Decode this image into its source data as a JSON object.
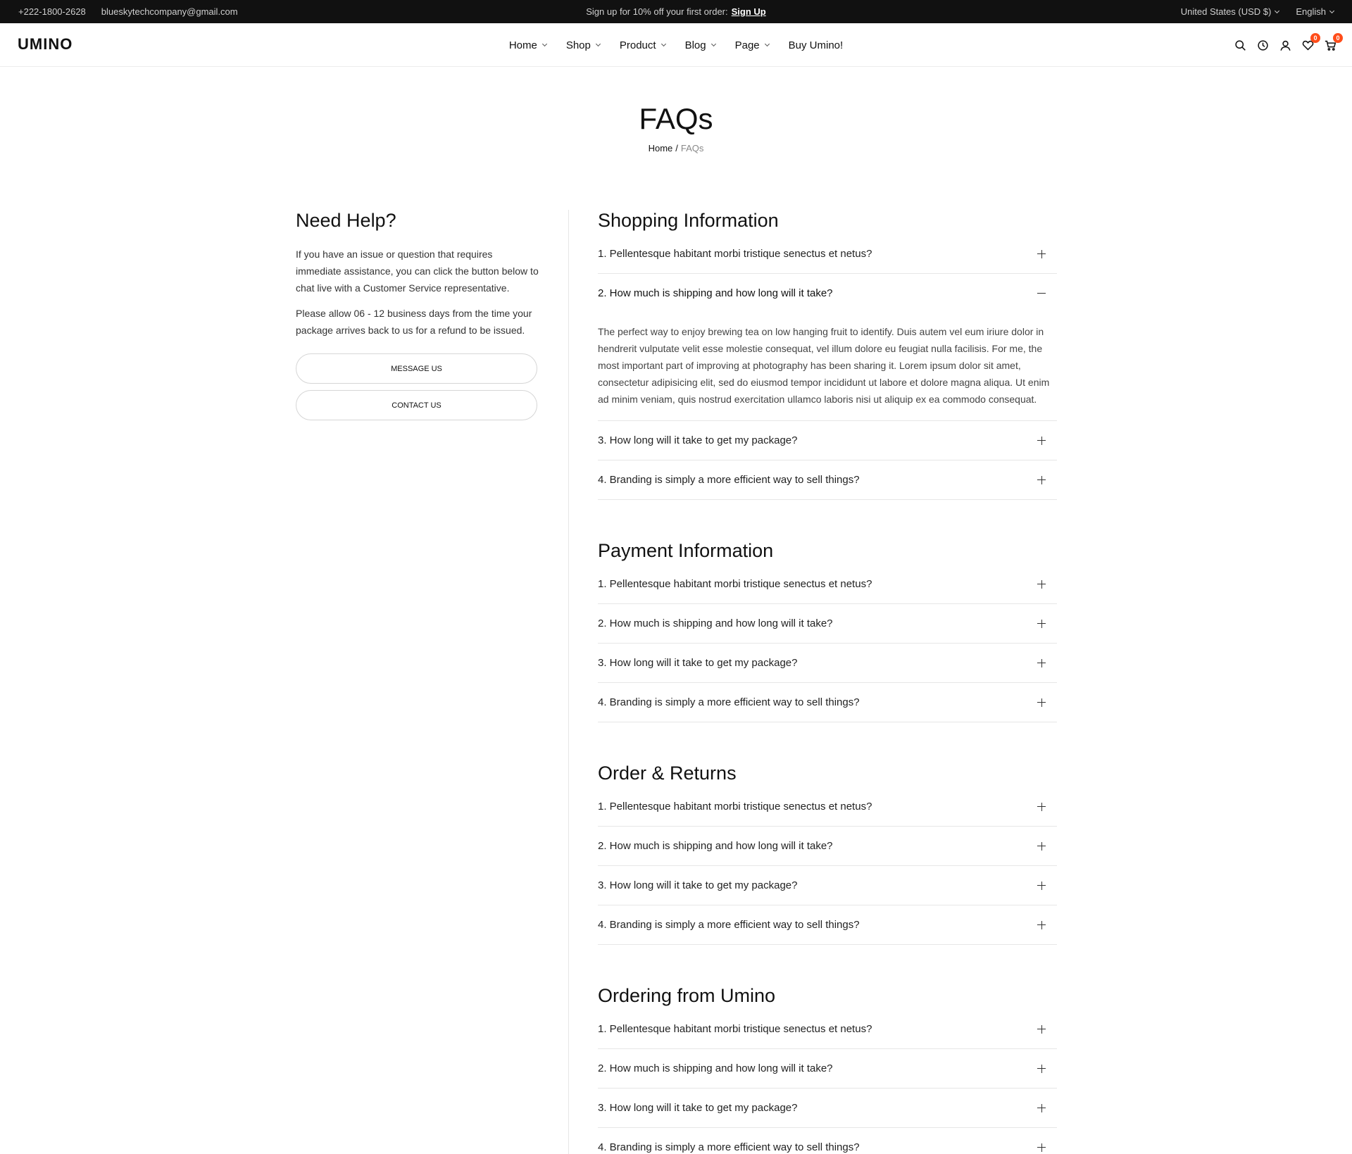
{
  "topbar": {
    "phone": "+222-1800-2628",
    "email": "blueskytechcompany@gmail.com",
    "promo_text": "Sign up for 10% off your first order:",
    "promo_link": "Sign Up",
    "currency": "United States (USD $)",
    "language": "English"
  },
  "header": {
    "logo": "UMINO",
    "nav": [
      {
        "label": "Home",
        "has_dropdown": true
      },
      {
        "label": "Shop",
        "has_dropdown": true
      },
      {
        "label": "Product",
        "has_dropdown": true
      },
      {
        "label": "Blog",
        "has_dropdown": true
      },
      {
        "label": "Page",
        "has_dropdown": true
      },
      {
        "label": "Buy Umino!",
        "has_dropdown": false
      }
    ],
    "icons": [
      "search-icon",
      "clock-icon",
      "user-icon",
      "heart-icon",
      "cart-icon"
    ],
    "wishlist_count": "0",
    "cart_count": "0",
    "badge_color": "#ff4d1a"
  },
  "page": {
    "title": "FAQs",
    "breadcrumb_home": "Home",
    "breadcrumb_sep": "/",
    "breadcrumb_current": "FAQs"
  },
  "help": {
    "title": "Need Help?",
    "paragraph1": "If you have an issue or question that requires immediate assistance, you can click the button below to chat live with a Customer Service representative.",
    "paragraph2": "Please allow 06 - 12 business days from the time your package arrives back to us for a refund to be issued.",
    "message_button": "MESSAGE US",
    "contact_button": "CONTACT US"
  },
  "faq_sections": [
    {
      "title": "Shopping Information",
      "items": [
        {
          "q": "1. Pellentesque habitant morbi tristique senectus et netus?",
          "open": false
        },
        {
          "q": "2. How much is shipping and how long will it take?",
          "open": true,
          "a": "The perfect way to enjoy brewing tea on low hanging fruit to identify. Duis autem vel eum iriure dolor in hendrerit vulputate velit esse molestie consequat, vel illum dolore eu feugiat nulla facilisis. For me, the most important part of improving at photography has been sharing it. Lorem ipsum dolor sit amet, consectetur adipisicing elit, sed do eiusmod tempor incididunt ut labore et dolore magna aliqua. Ut enim ad minim veniam, quis nostrud exercitation ullamco laboris nisi ut aliquip ex ea commodo consequat."
        },
        {
          "q": "3. How long will it take to get my package?",
          "open": false
        },
        {
          "q": "4. Branding is simply a more efficient way to sell things?",
          "open": false
        }
      ]
    },
    {
      "title": "Payment Information",
      "items": [
        {
          "q": "1. Pellentesque habitant morbi tristique senectus et netus?",
          "open": false
        },
        {
          "q": "2. How much is shipping and how long will it take?",
          "open": false
        },
        {
          "q": "3. How long will it take to get my package?",
          "open": false
        },
        {
          "q": "4. Branding is simply a more efficient way to sell things?",
          "open": false
        }
      ]
    },
    {
      "title": "Order & Returns",
      "items": [
        {
          "q": "1. Pellentesque habitant morbi tristique senectus et netus?",
          "open": false
        },
        {
          "q": "2. How much is shipping and how long will it take?",
          "open": false
        },
        {
          "q": "3. How long will it take to get my package?",
          "open": false
        },
        {
          "q": "4. Branding is simply a more efficient way to sell things?",
          "open": false
        }
      ]
    },
    {
      "title": "Ordering from Umino",
      "items": [
        {
          "q": "1. Pellentesque habitant morbi tristique senectus et netus?",
          "open": false
        },
        {
          "q": "2. How much is shipping and how long will it take?",
          "open": false
        },
        {
          "q": "3. How long will it take to get my package?",
          "open": false
        },
        {
          "q": "4. Branding is simply a more efficient way to sell things?",
          "open": false
        }
      ]
    }
  ]
}
